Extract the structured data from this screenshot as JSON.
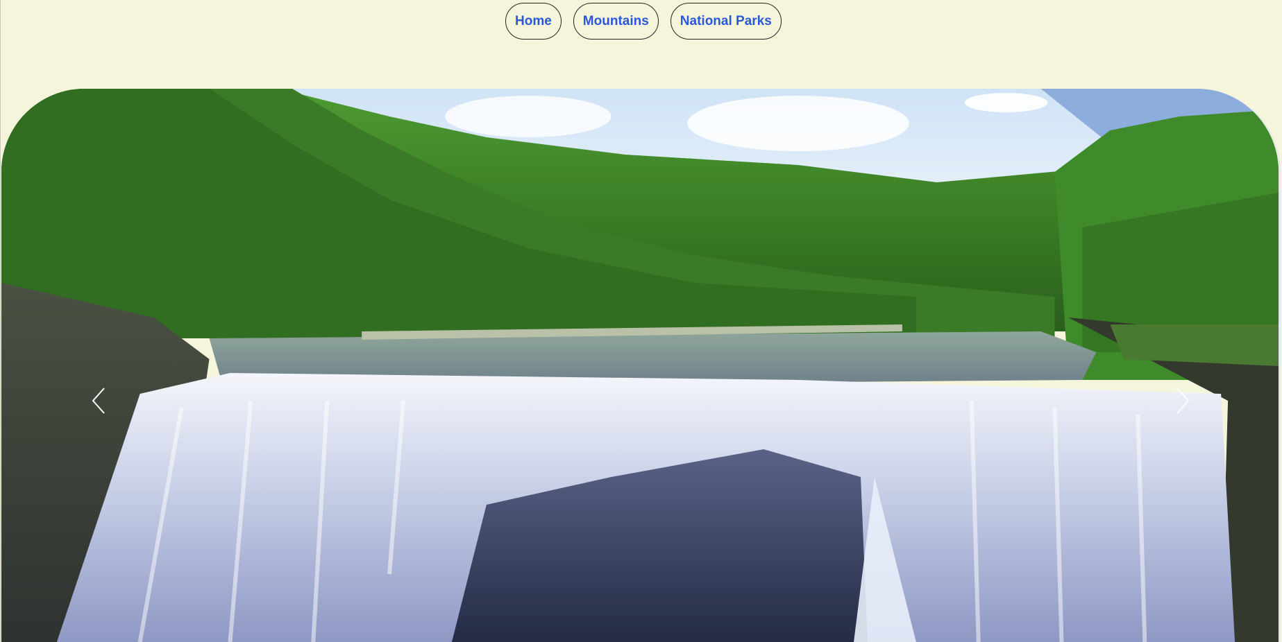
{
  "nav": {
    "items": [
      {
        "label": "Home"
      },
      {
        "label": "Mountains"
      },
      {
        "label": "National Parks"
      }
    ],
    "link_color": "#2b58d8",
    "border_color": "#222222"
  },
  "page": {
    "background_color": "#f5f5dc"
  },
  "carousel": {
    "image_subject": "waterfall-landscape",
    "prev_icon": "chevron-left-icon",
    "next_icon": "chevron-right-icon"
  }
}
